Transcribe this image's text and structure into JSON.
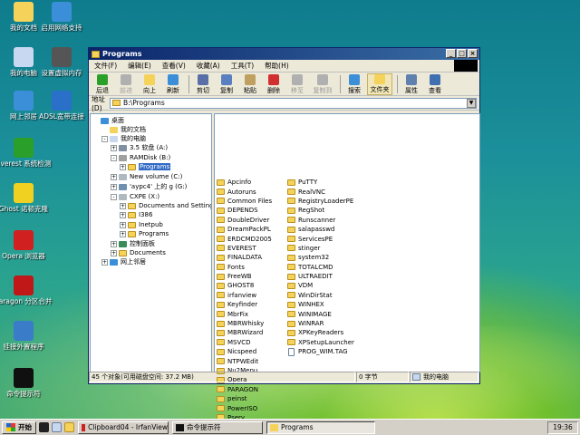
{
  "desktop": {
    "icons": [
      {
        "label": "我的文档",
        "icon": "my-documents-icon",
        "color": "#f5d35b"
      },
      {
        "label": "启用网络支持",
        "icon": "network-globe-icon",
        "color": "#3b8ed8"
      },
      {
        "label": "我的电脑",
        "icon": "my-computer-icon",
        "color": "#c8d8f0"
      },
      {
        "label": "设置虚拟内存",
        "icon": "memory-chip-icon",
        "color": "#555555"
      },
      {
        "label": "网上邻居",
        "icon": "network-places-icon",
        "color": "#3b8ed8"
      },
      {
        "label": "ADSL宽带连接",
        "icon": "adsl-globe-icon",
        "color": "#2a6fc8"
      },
      {
        "label": "Everest 系统检测",
        "icon": "everest-info-icon",
        "color": "#2aa02a"
      },
      {
        "label": "Ghost 诺顿克隆",
        "icon": "ghost-icon",
        "color": "#f0d020"
      },
      {
        "label": "Opera 浏览器",
        "icon": "opera-icon",
        "color": "#d02020"
      },
      {
        "label": "Paragon 分区合并",
        "icon": "paragon-icon",
        "color": "#c01818"
      },
      {
        "label": "挂接外置程序",
        "icon": "mount-programs-icon",
        "color": "#3a7cc8"
      },
      {
        "label": "命令提示符",
        "icon": "command-prompt-icon",
        "color": "#101010"
      }
    ]
  },
  "window": {
    "title": "Programs",
    "menu": [
      "文件(F)",
      "编辑(E)",
      "查看(V)",
      "收藏(A)",
      "工具(T)",
      "帮助(H)"
    ],
    "toolbar": [
      {
        "label": "后退",
        "icon": "back-arrow-icon",
        "color": "#2aa02a",
        "enabled": true
      },
      {
        "label": "前进",
        "icon": "forward-arrow-icon",
        "color": "#b0b0b0",
        "enabled": false
      },
      {
        "label": "向上",
        "icon": "up-folder-icon",
        "color": "#f5d35b",
        "enabled": true
      },
      {
        "label": "刷新",
        "icon": "refresh-icon",
        "color": "#3b8ed8",
        "enabled": true
      },
      {
        "label": "剪切",
        "icon": "cut-icon",
        "color": "#5a6fa8",
        "enabled": true
      },
      {
        "label": "复制",
        "icon": "copy-icon",
        "color": "#5a7fc0",
        "enabled": true
      },
      {
        "label": "粘贴",
        "icon": "paste-icon",
        "color": "#c0a060",
        "enabled": true
      },
      {
        "label": "删除",
        "icon": "delete-icon",
        "color": "#d03030",
        "enabled": true
      },
      {
        "label": "移至",
        "icon": "move-to-icon",
        "color": "#b0b0b0",
        "enabled": false
      },
      {
        "label": "复制到",
        "icon": "copy-to-icon",
        "color": "#b0b0b0",
        "enabled": false
      },
      {
        "label": "搜索",
        "icon": "search-icon",
        "color": "#3b8ed8",
        "enabled": true
      },
      {
        "label": "文件夹",
        "icon": "folders-icon",
        "color": "#f5d35b",
        "enabled": true,
        "active": true
      },
      {
        "label": "属性",
        "icon": "properties-icon",
        "color": "#6080b0",
        "enabled": true
      },
      {
        "label": "查看",
        "icon": "views-icon",
        "color": "#4070b0",
        "enabled": true
      }
    ],
    "address": {
      "label": "地址(D)",
      "value": "B:\\Programs"
    },
    "tree": [
      {
        "label": "桌面",
        "icon": "desktop-icon"
      },
      {
        "label": "我的文档",
        "icon": "my-documents-icon"
      },
      {
        "label": "我的电脑",
        "icon": "my-computer-icon"
      },
      {
        "label": "3.5 软盘 (A:)",
        "icon": "floppy-icon"
      },
      {
        "label": "RAMDisk (B:)",
        "icon": "ramdisk-icon"
      },
      {
        "label": "Programs",
        "icon": "folder-icon",
        "selected": true
      },
      {
        "label": "New volume (C:)",
        "icon": "drive-icon"
      },
      {
        "label": "'aypc4' 上的 g (G:)",
        "icon": "network-drive-icon"
      },
      {
        "label": "CXPE (X:)",
        "icon": "drive-icon"
      },
      {
        "label": "Documents and Settings",
        "icon": "folder-icon"
      },
      {
        "label": "I386",
        "icon": "folder-icon"
      },
      {
        "label": "Inetpub",
        "icon": "folder-icon"
      },
      {
        "label": "Programs",
        "icon": "folder-icon"
      },
      {
        "label": "控制面板",
        "icon": "control-panel-icon"
      },
      {
        "label": "Documents",
        "icon": "folder-icon"
      },
      {
        "label": "网上邻居",
        "icon": "network-places-icon"
      }
    ],
    "files_col1": [
      "Apcinfo",
      "Autoruns",
      "Common Files",
      "DEPENDS",
      "DoubleDriver",
      "DreamPackPL",
      "ERDCMD2005",
      "EVEREST",
      "FINALDATA",
      "Fonts",
      "FreeWB",
      "GHOST8",
      "irfanview",
      "Keyfinder",
      "MbrFix",
      "MBRWhisky",
      "MBRWizard",
      "MSVCD",
      "Nicspeed",
      "NTPWEdit",
      "Nu2Menu",
      "Opera",
      "PARAGON",
      "peinst",
      "PowerISO",
      "Pserv"
    ],
    "files_col2": [
      "PuTTY",
      "RealVNC",
      "RegistryLoaderPE",
      "RegShot",
      "Runscanner",
      "salapasswd",
      "ServicesPE",
      "stinger",
      "system32",
      "TOTALCMD",
      "ULTRAEDIT",
      "VDM",
      "WinDirStat",
      "WINHEX",
      "WINIMAGE",
      "WINRAR",
      "XPKeyReaders",
      "XPSetupLauncher",
      "PROG_WIM.TAG"
    ],
    "status": {
      "objects": "45 个对象(可用磁盘空间: 37.2 MB)",
      "size": "0 字节",
      "location": "我的电脑"
    }
  },
  "taskbar": {
    "start": "开始",
    "tasks": [
      {
        "label": "Clipboard04 - IrfanView",
        "icon": "irfanview-icon",
        "color": "#d02020"
      },
      {
        "label": "命令提示符",
        "icon": "command-prompt-icon",
        "color": "#101010"
      },
      {
        "label": "Programs",
        "icon": "folder-icon",
        "color": "#f5d35b",
        "active": true
      }
    ],
    "clock": "19:36"
  }
}
